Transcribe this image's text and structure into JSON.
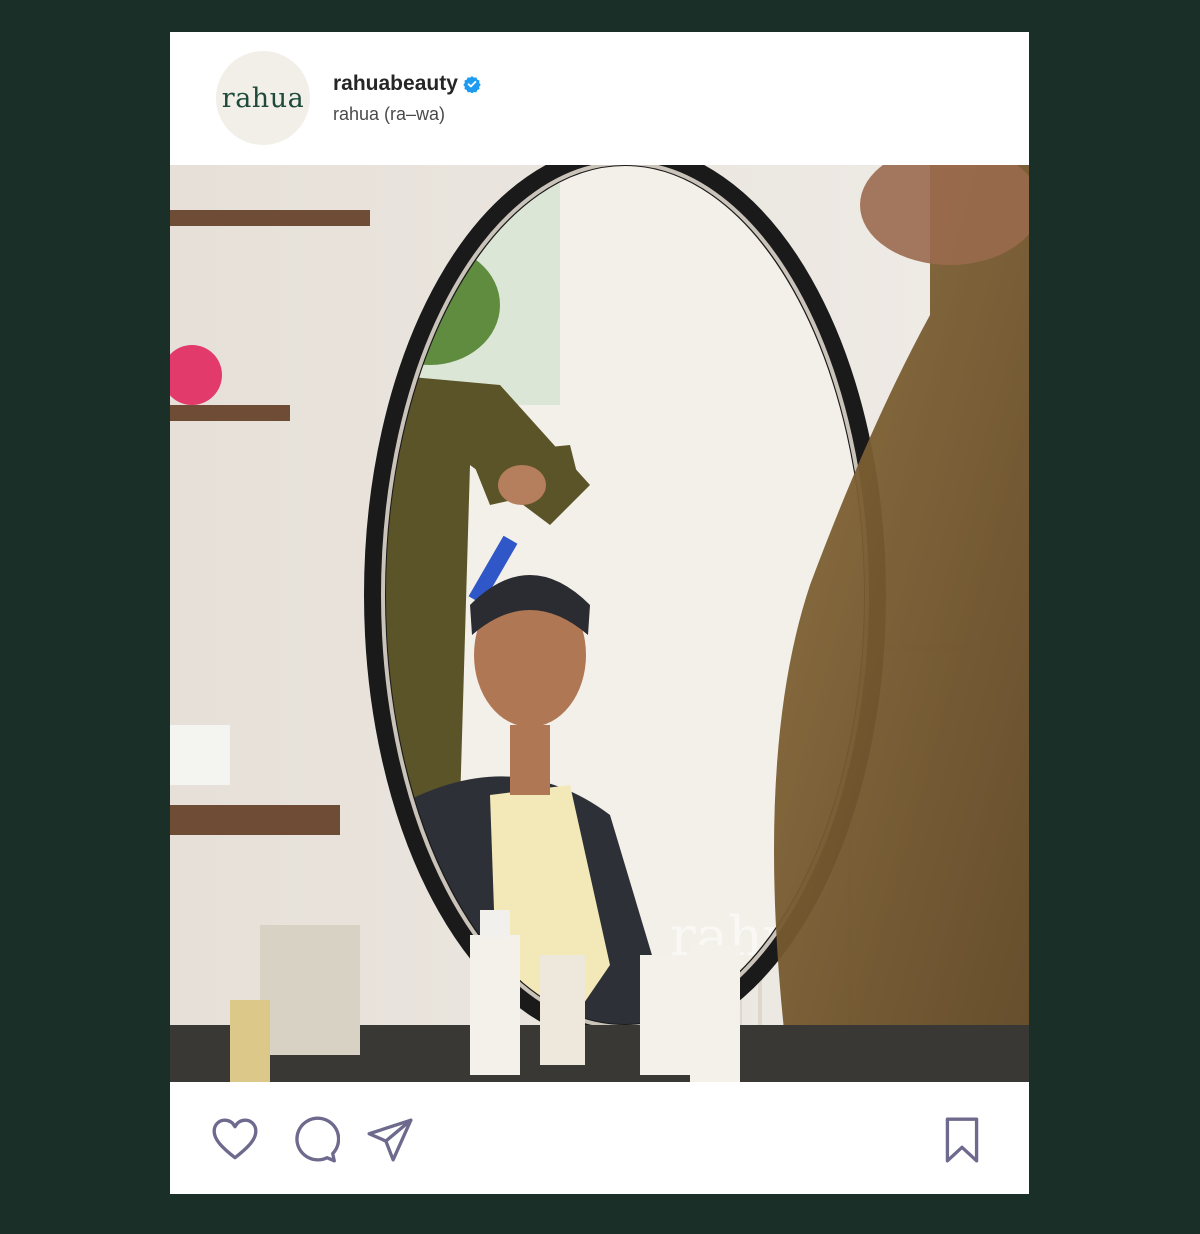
{
  "theme": {
    "background": "#1a2f28",
    "card": "#ffffff",
    "icon_color": "#6e6a8e",
    "verified_color": "#1d9bf0",
    "brand_green": "#1d4a3a"
  },
  "post": {
    "avatar_text": "rahua",
    "username": "rahuabeauty",
    "verified": true,
    "subtitle": "rahua (ra–wa)",
    "image": {
      "watermark": "rahua"
    },
    "actions": {
      "like_icon": "heart-icon",
      "comment_icon": "comment-icon",
      "share_icon": "send-icon",
      "save_icon": "bookmark-icon"
    }
  }
}
